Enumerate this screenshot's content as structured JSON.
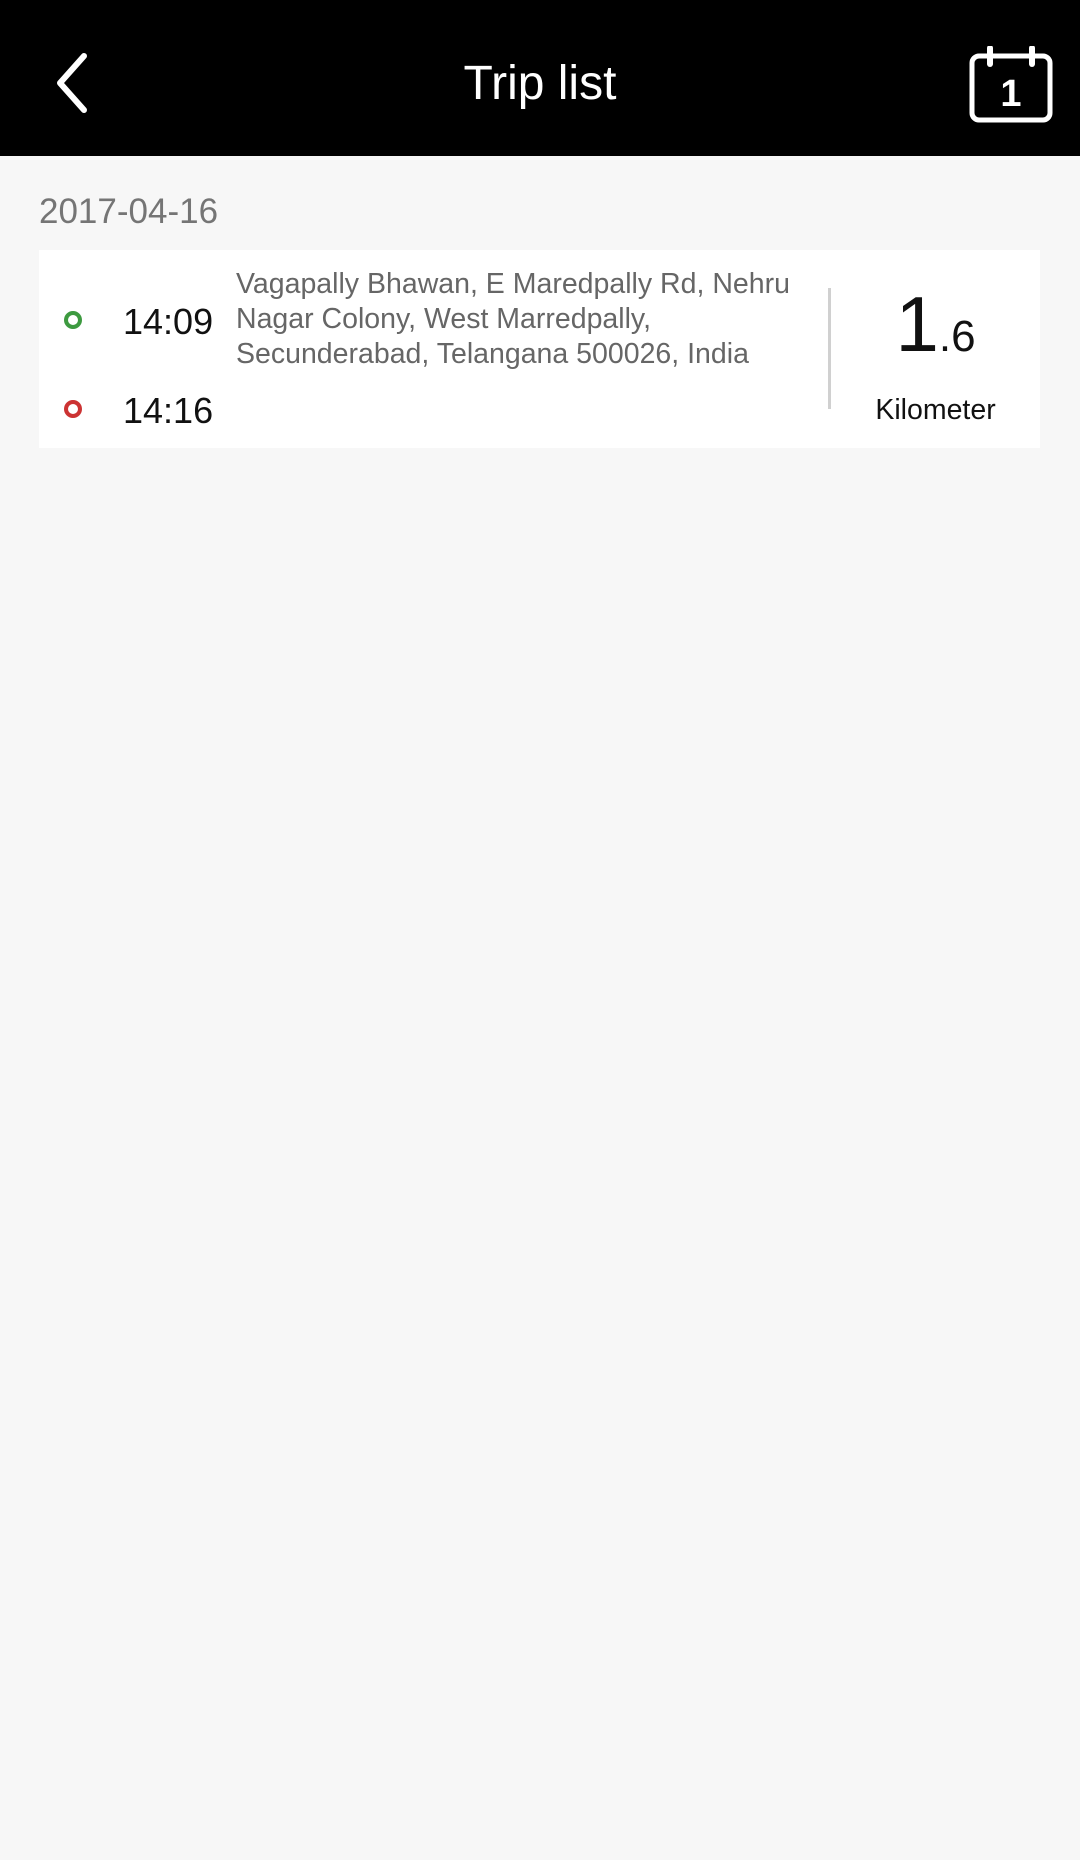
{
  "header": {
    "title": "Trip list",
    "back_icon": "chevron-left-icon",
    "calendar_icon": "calendar-icon",
    "calendar_day": "1"
  },
  "trip_groups": [
    {
      "date": "2017-04-16",
      "trips": [
        {
          "start_time": "14:09",
          "end_time": "14:16",
          "address": "Vagapally Bhawan, E Maredpally Rd, Nehru Nagar Colony, West Marredpally, Secunderabad, Telangana 500026, India",
          "distance_int": "1",
          "distance_dec": ".6",
          "distance_unit": "Kilometer"
        }
      ]
    }
  ],
  "colors": {
    "header_bg": "#000000",
    "page_bg": "#f7f7f7",
    "start_marker": "#3d9a40",
    "end_marker": "#cc3333"
  }
}
